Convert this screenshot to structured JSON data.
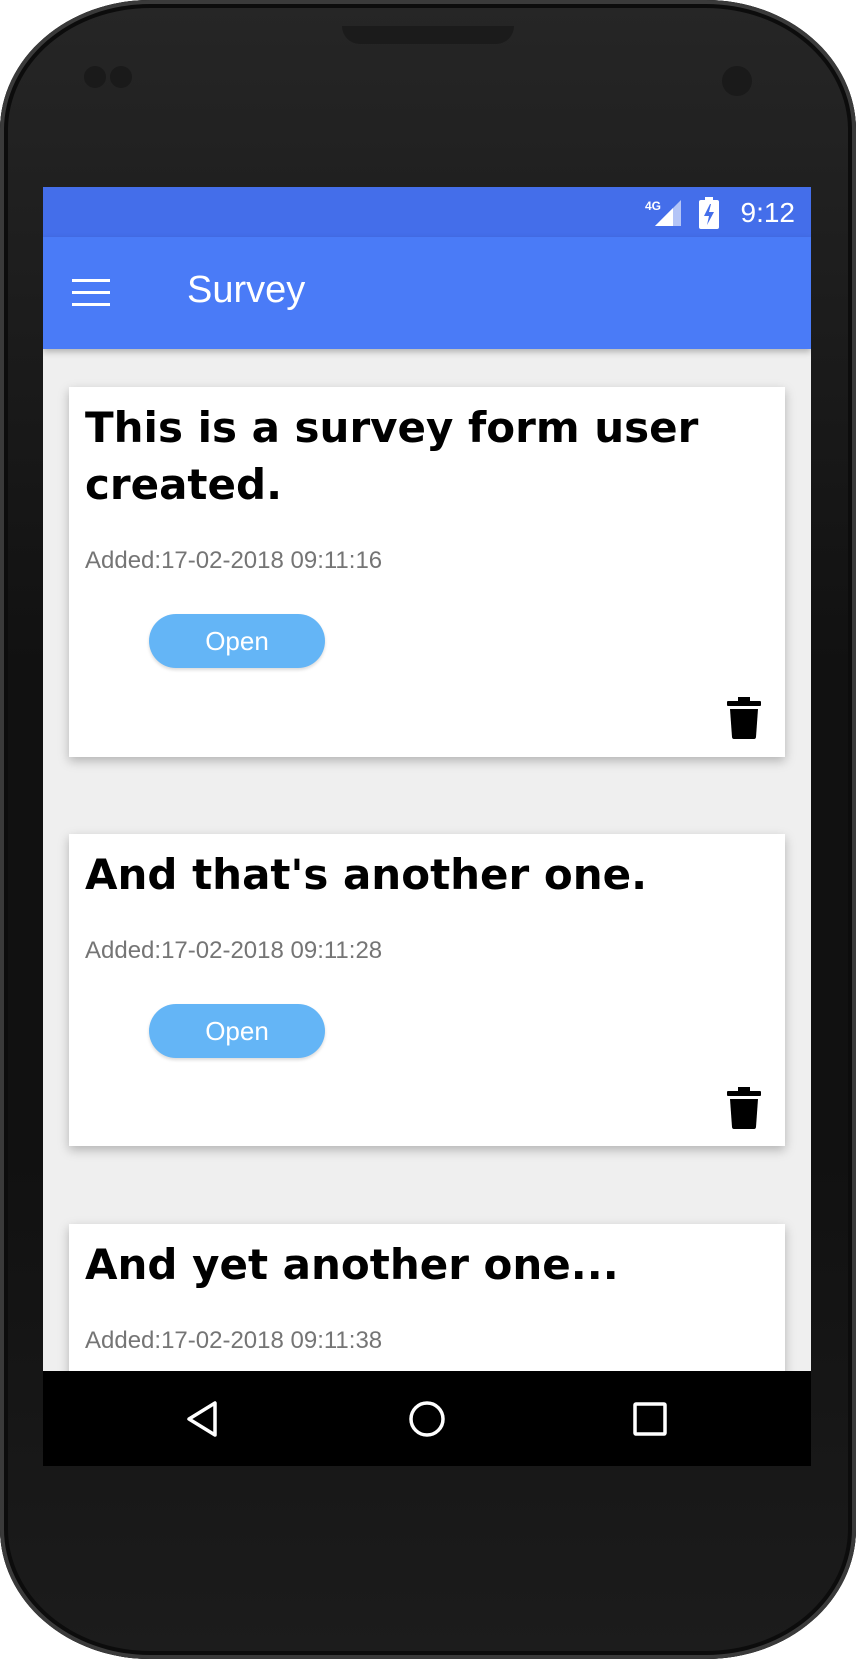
{
  "status_bar": {
    "time": "9:12",
    "network": "4G",
    "icons": [
      "signal-icon",
      "battery-charging-icon"
    ]
  },
  "app_bar": {
    "title": "Survey",
    "menu_icon": "hamburger-menu-icon"
  },
  "surveys": [
    {
      "title": "This is a survey form user created.",
      "added": "Added:17-02-2018 09:11:16",
      "open_label": "Open"
    },
    {
      "title": "And that's another one.",
      "added": "Added:17-02-2018 09:11:28",
      "open_label": "Open"
    },
    {
      "title": "And yet another one...",
      "added": "Added:17-02-2018 09:11:38"
    }
  ],
  "nav_bar": {
    "icons": [
      "back-icon",
      "home-icon",
      "recents-icon"
    ]
  },
  "colors": {
    "status_bar": "#446eea",
    "app_bar": "#4a7bf7",
    "open_button": "#64b5f6",
    "background": "#efefef"
  }
}
